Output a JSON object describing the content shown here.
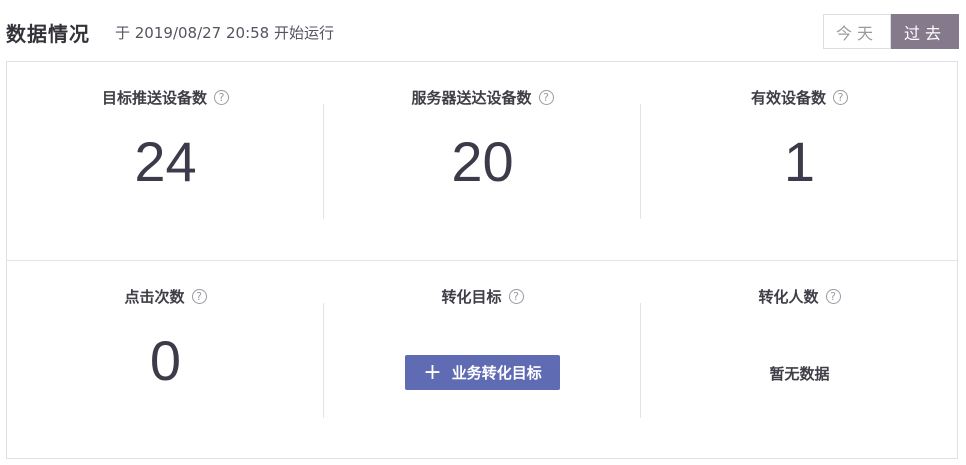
{
  "header": {
    "title": "数据情况",
    "subtitle": "于 2019/08/27 20:58 开始运行"
  },
  "toggle": {
    "today_label": "今天",
    "past_label": "过去",
    "selected": "过去"
  },
  "stats": [
    {
      "label": "目标推送设备数",
      "value": "24"
    },
    {
      "label": "服务器送达设备数",
      "value": "20"
    },
    {
      "label": "有效设备数",
      "value": "1"
    },
    {
      "label": "点击次数",
      "value": "0"
    },
    {
      "label": "转化目标",
      "button_label": "业务转化目标"
    },
    {
      "label": "转化人数",
      "empty_text": "暂无数据"
    }
  ],
  "help_icon_glyph": "?",
  "plus_icon_glyph": "+",
  "colors": {
    "accent_button": "#5f6bb3",
    "toggle_active": "#857a8c",
    "number_text": "#3e3a4a"
  }
}
